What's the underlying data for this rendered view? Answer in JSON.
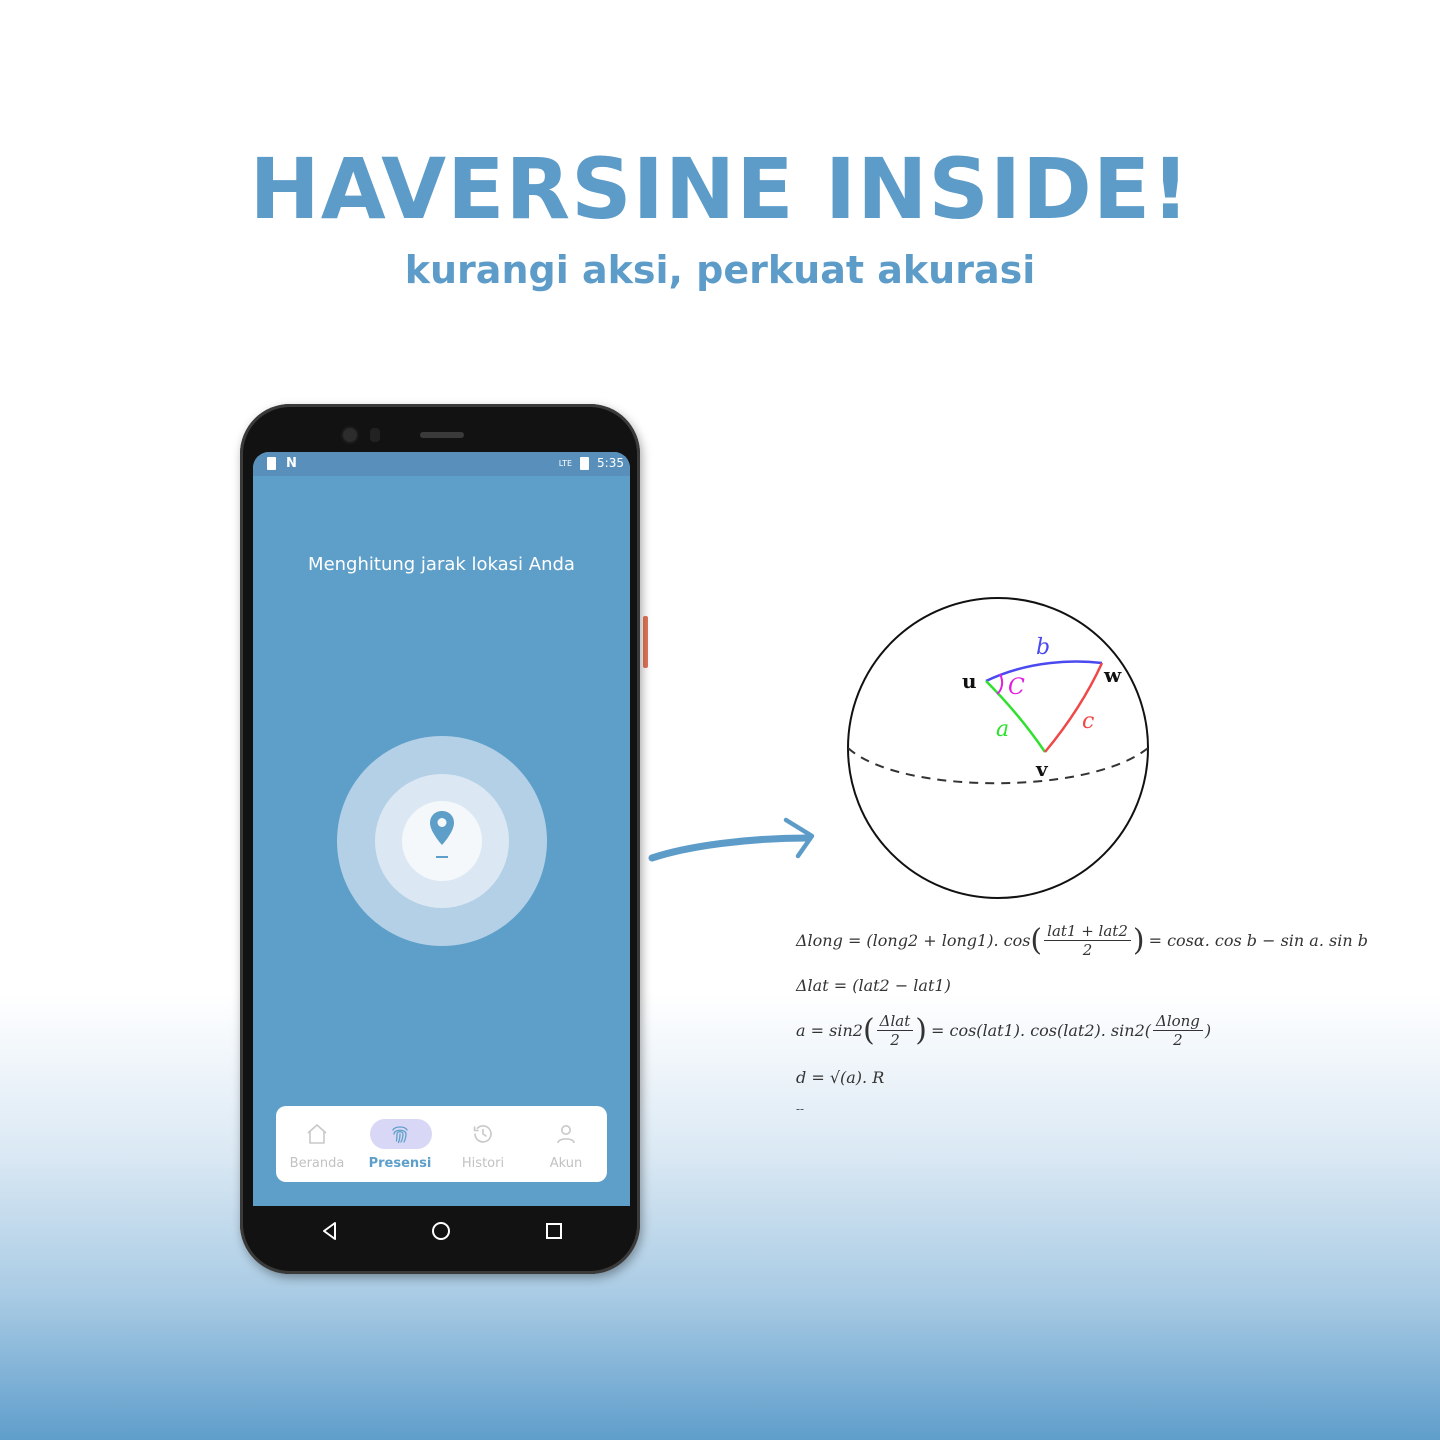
{
  "headline": "HAVERSINE INSIDE!",
  "tagline": "kurangi aksi, perkuat akurasi",
  "phone": {
    "status_time": "5:35",
    "status_n": "N",
    "status_lte": "LTE",
    "screen_title": "Menghitung jarak lokasi Anda",
    "pin_dash": "–",
    "nav": [
      {
        "label": "Beranda",
        "icon": "home-icon"
      },
      {
        "label": "Presensi",
        "icon": "fingerprint-icon",
        "active": true
      },
      {
        "label": "Histori",
        "icon": "history-icon"
      },
      {
        "label": "Akun",
        "icon": "user-icon"
      }
    ]
  },
  "diagram": {
    "label_u": "u",
    "label_w": "w",
    "label_v": "v",
    "label_a": "a",
    "label_b": "b",
    "label_c": "c",
    "label_C": "C"
  },
  "formulas": {
    "f1_left": "Δlong = (long2 + long1). cos",
    "f1_num": "lat1 + lat2",
    "f1_den": "2",
    "f1_right": "= cosα. cos b − sin a. sin b",
    "f2": "Δlat = (lat2 − lat1)",
    "f3_left": "a = sin2",
    "f3_num": "Δlat",
    "f3_den": "2",
    "f3_mid": "= cos(lat1). cos(lat2). sin2(",
    "f3_num2": "Δlong",
    "f3_den2": "2",
    "f3_close": ")",
    "f4": "d = √(a). R",
    "dots": "--"
  },
  "colors": {
    "accent": "#5d9cc8",
    "screen_bg": "#5e9fc9",
    "arc_b": "#4a4af0",
    "arc_a": "#30e030",
    "arc_c": "#f04848",
    "angle_C": "#e020e0"
  }
}
